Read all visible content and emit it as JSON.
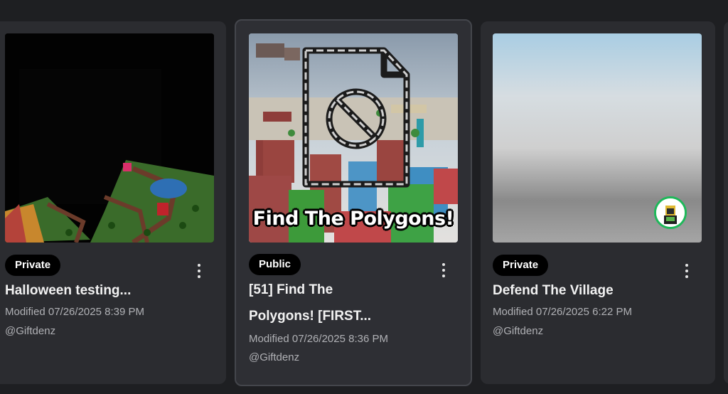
{
  "cards": [
    {
      "visibility": "Private",
      "title": "Halloween testing...",
      "modified": "Modified 07/26/2025 8:39 PM",
      "creator": "@Giftdenz"
    },
    {
      "visibility": "Public",
      "title_line1": "[51] Find The",
      "title_line2": "Polygons! [FIRST...",
      "thumbnail_caption": "Find The Polygons!",
      "modified": "Modified 07/26/2025 8:36 PM",
      "creator": "@Giftdenz"
    },
    {
      "visibility": "Private",
      "title": "Defend The Village",
      "modified": "Modified 07/26/2025 6:22 PM",
      "creator": "@Giftdenz"
    }
  ],
  "icons": {
    "more": "more-options-icon",
    "broken_file": "broken-file-icon",
    "avatar": "avatar-icon"
  },
  "colors": {
    "background": "#1e1f22",
    "card": "#2b2c30",
    "badge": "#000000",
    "avatar_ring": "#1fb85a"
  }
}
